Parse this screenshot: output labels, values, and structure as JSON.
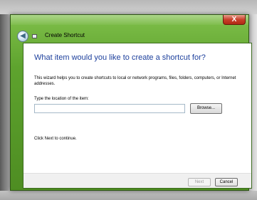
{
  "window": {
    "title": "Create Shortcut",
    "close_glyph": "X",
    "back_glyph": "◀",
    "frame_color": "#5ea32e"
  },
  "icons": {
    "back": "back-arrow-icon",
    "wizard": "shortcut-wizard-icon",
    "close": "close-icon"
  },
  "wizard": {
    "heading": "What item would you like to create a shortcut for?",
    "description": "This wizard helps you to create shortcuts to local or network programs, files, folders, computers, or Internet addresses.",
    "location_label": "Type the location of the item:",
    "location_value": "",
    "browse_label": "Browse...",
    "continue_text": "Click Next to continue."
  },
  "footer": {
    "next_label": "Next",
    "cancel_label": "Cancel"
  },
  "colors": {
    "heading": "#1c3f9c",
    "disabled_text": "#9a9a9a"
  }
}
